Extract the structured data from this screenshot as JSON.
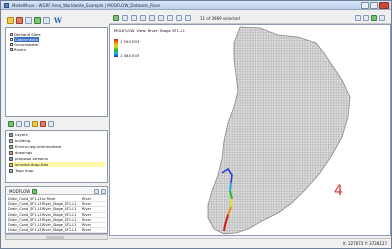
{
  "window": {
    "title": "ModelMuse - WGRF Area_Worldwide_Example | MODFLOW_Datasets_River"
  },
  "left_toolbar": {
    "logo": "W"
  },
  "tree": {
    "items": [
      {
        "label": "Demand Sites",
        "selected": false
      },
      {
        "label": "Catchments",
        "selected": true
      },
      {
        "label": "Groundwater",
        "selected": false
      },
      {
        "label": "Rivers",
        "selected": false
      }
    ]
  },
  "layers": {
    "header": "Layers",
    "items": [
      {
        "label": "building"
      },
      {
        "label": "Enviro-neg-intermediate"
      },
      {
        "label": "drawings"
      },
      {
        "label": "proposal-streams"
      },
      {
        "label": "lorraine-drop-title",
        "highlighted": true
      },
      {
        "label": "Topo map"
      }
    ]
  },
  "table": {
    "title": "MODFLOW",
    "columns": [
      "",
      "",
      ""
    ],
    "rows": [
      [
        "Drain_Cond_SF1-L1",
        "to River",
        "River"
      ],
      [
        "Drain_Cond_SF1-L1",
        "River_Stage_SF1-L1",
        "River"
      ],
      [
        "Drain_Cond_SF1-L1",
        "River_Stage_SF1-L1",
        "River"
      ],
      [
        "Drain_Cond_SF1-L1",
        "River_Stage_SF1-L1",
        "River"
      ],
      [
        "Drain_Cond_SF1-L1",
        "River_Stage_SF1-L1",
        "River"
      ],
      [
        "Drain_Cond_SF1-L1",
        "River_Stage_SF1-L1",
        "River"
      ],
      [
        "Drain_Cond_SF1-L1",
        "River_Stage_SF1-L1",
        "River"
      ]
    ]
  },
  "map_toolbar": {
    "selection_text": "11 of 3969 selected"
  },
  "map": {
    "legend_title": "MODFLOW: View: River: Stage SF1-L1",
    "legend_max": "1 594 E03",
    "legend_min": "1 484 E03",
    "callout_number": "4",
    "colors": {
      "domain_fill": "#d9d9d9",
      "domain_stroke": "#9a9a9a",
      "callout": "#d8352a"
    }
  },
  "status": {
    "coordinates": "X: 227072 Y: 3728127"
  }
}
